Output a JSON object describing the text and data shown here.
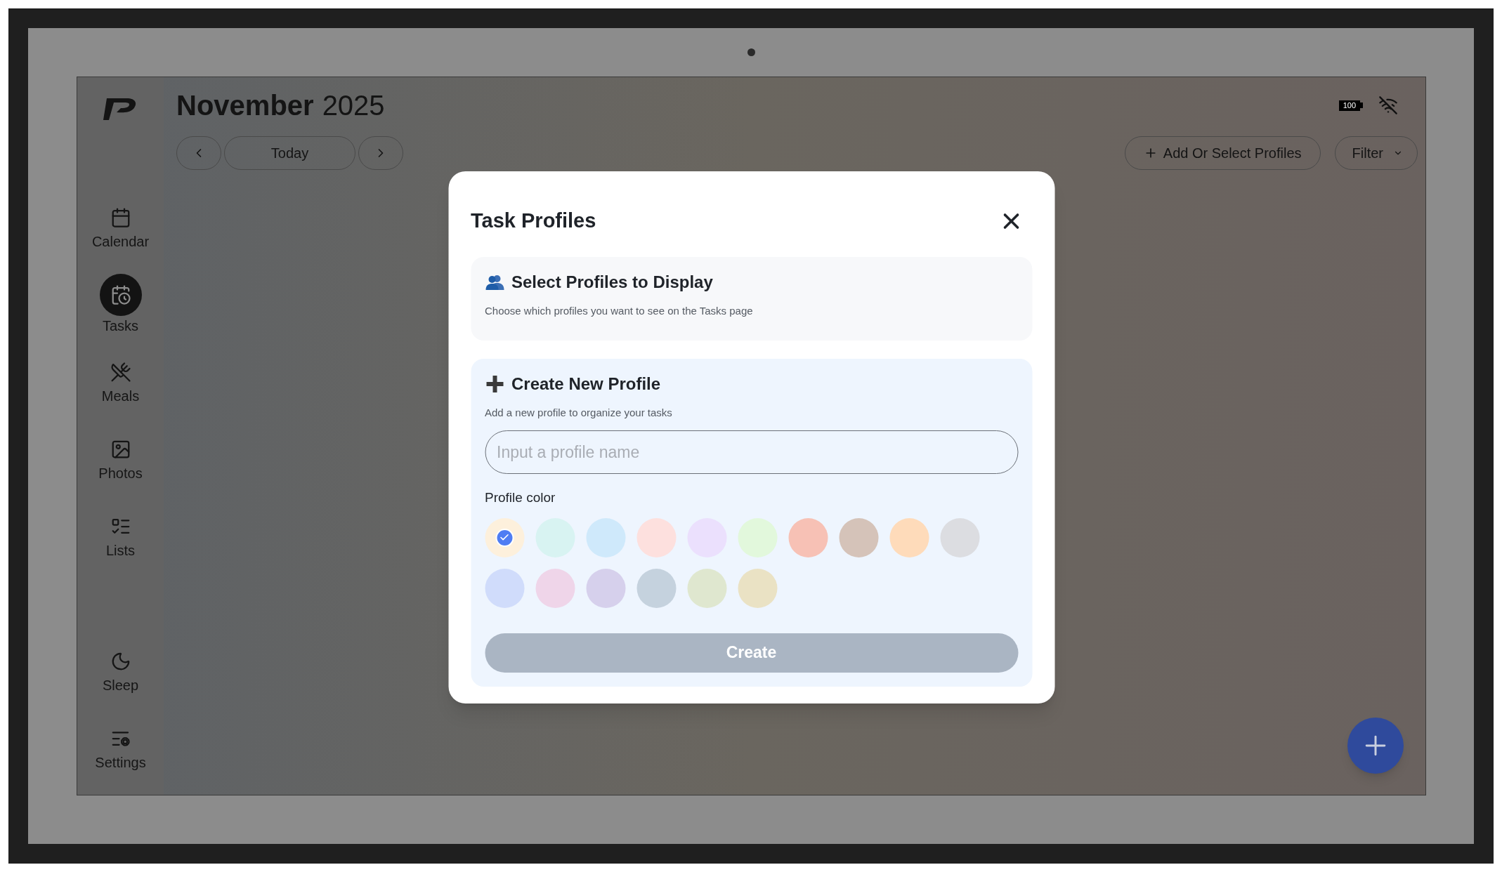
{
  "header": {
    "month": "November",
    "year": "2025",
    "today_button": "Today",
    "add_profiles_button": "Add Or Select Profiles",
    "filter_button": "Filter"
  },
  "status": {
    "battery": "100"
  },
  "sidebar": {
    "items": [
      {
        "label": "Calendar",
        "kind": "calendar",
        "selected": false
      },
      {
        "label": "Tasks",
        "kind": "tasks",
        "selected": true
      },
      {
        "label": "Meals",
        "kind": "meals",
        "selected": false
      },
      {
        "label": "Photos",
        "kind": "photos",
        "selected": false
      },
      {
        "label": "Lists",
        "kind": "lists",
        "selected": false
      }
    ],
    "bottom_items": [
      {
        "label": "Sleep",
        "kind": "sleep",
        "selected": false
      },
      {
        "label": "Settings",
        "kind": "settings",
        "selected": false
      }
    ]
  },
  "dialog": {
    "title": "Task Profiles",
    "select_section": {
      "title": "Select Profiles to Display",
      "subtitle": "Choose which profiles you want to see on the Tasks page"
    },
    "create_section": {
      "title": "Create New Profile",
      "subtitle": "Add a new profile to organize your tasks",
      "name_field": {
        "placeholder": "Input a profile name"
      },
      "color_label": "Profile color",
      "colors": [
        {
          "color": "#fdf0dc",
          "selected": true
        },
        {
          "color": "#d8f3f2",
          "selected": false
        },
        {
          "color": "#cfe9fb",
          "selected": false
        },
        {
          "color": "#fde0de",
          "selected": false
        },
        {
          "color": "#ebe0fd",
          "selected": false
        },
        {
          "color": "#e2f8dc",
          "selected": false
        },
        {
          "color": "#f7c1b5",
          "selected": false
        },
        {
          "color": "#d5c3b9",
          "selected": false
        },
        {
          "color": "#fedbba",
          "selected": false
        },
        {
          "color": "#dcdde1",
          "selected": false
        },
        {
          "color": "#d0dcfb",
          "selected": false
        },
        {
          "color": "#efd5e9",
          "selected": false
        },
        {
          "color": "#d6d0ec",
          "selected": false
        },
        {
          "color": "#c5d2de",
          "selected": false
        },
        {
          "color": "#dfe7cf",
          "selected": false
        },
        {
          "color": "#eae2c4",
          "selected": false
        }
      ],
      "create_button": {
        "label": "Create",
        "disabled": true
      }
    }
  }
}
